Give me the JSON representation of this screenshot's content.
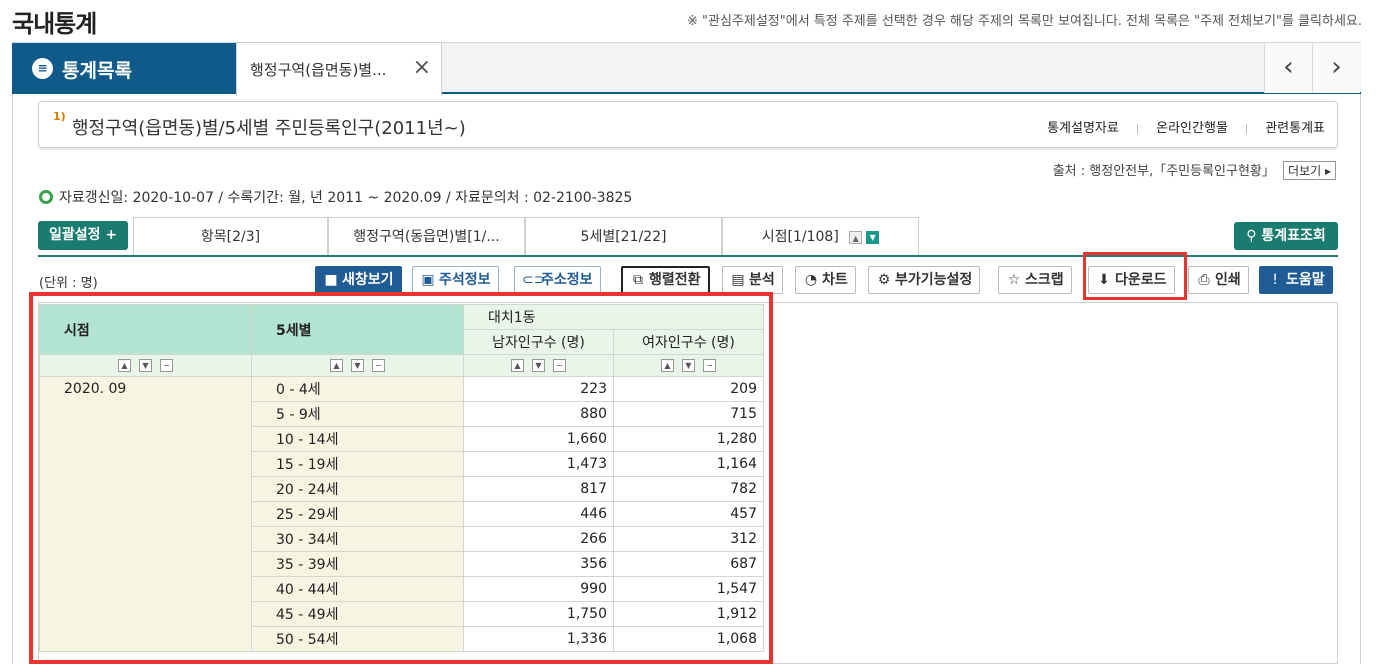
{
  "header": {
    "title": "국내통계",
    "notice": "※ \"관심주제설정\"에서 특정 주제를 선택한 경우 해당 주제의 목록만 보여집니다. 전체 목록은 \"주제 전체보기\"를 클릭하세요."
  },
  "tabs": {
    "list_icon": "list-icon",
    "list_label": "통계목록",
    "active_label": "행정구역(읍면동)별...",
    "close": "×",
    "prev": "‹",
    "next": "›"
  },
  "title_box": {
    "sup": "1)",
    "title": "행정구역(읍면동)별/5세별 주민등록인구(2011년~)",
    "links": [
      "통계설명자료",
      "온라인간행물",
      "관련통계표"
    ]
  },
  "source": {
    "text": "출처 : 행정안전부,「주민등록인구현황」",
    "more": "더보기 ▸"
  },
  "info": "자료갱신일: 2020-10-07 / 수록기간: 월, 년 2011 ~ 2020.09 / 자료문의처 : 02-2100-3825",
  "filters": {
    "bulk": "일괄설정 +",
    "tabs": [
      "항목[2/3]",
      "행정구역(동읍면)별[1/...",
      "5세별[21/22]",
      "시점[1/108]"
    ],
    "query": "통계표조회"
  },
  "unit": "(단위 : 명)",
  "toolbar": [
    {
      "icon": "■",
      "label": "새창보기"
    },
    {
      "icon": "▣",
      "label": "주석정보"
    },
    {
      "icon": "⊂⊃",
      "label": "주소정보"
    },
    {
      "icon": "⧉",
      "label": "행렬전환"
    },
    {
      "icon": "▤",
      "label": "분석"
    },
    {
      "icon": "◔",
      "label": "차트"
    },
    {
      "icon": "⚙",
      "label": "부가기능설정"
    },
    {
      "icon": "☆",
      "label": "스크랩"
    },
    {
      "icon": "⬇",
      "label": "다운로드"
    },
    {
      "icon": "⎙",
      "label": "인쇄"
    },
    {
      "icon": "!",
      "label": "도움말"
    }
  ],
  "table": {
    "col_time": "시점",
    "col_age": "5세별",
    "region": "대치1동",
    "col_male": "남자인구수 (명)",
    "col_female": "여자인구수 (명)",
    "period": "2020. 09",
    "rows": [
      {
        "age": "0 - 4세",
        "male": "223",
        "female": "209"
      },
      {
        "age": "5 - 9세",
        "male": "880",
        "female": "715"
      },
      {
        "age": "10 - 14세",
        "male": "1,660",
        "female": "1,280"
      },
      {
        "age": "15 - 19세",
        "male": "1,473",
        "female": "1,164"
      },
      {
        "age": "20 - 24세",
        "male": "817",
        "female": "782"
      },
      {
        "age": "25 - 29세",
        "male": "446",
        "female": "457"
      },
      {
        "age": "30 - 34세",
        "male": "266",
        "female": "312"
      },
      {
        "age": "35 - 39세",
        "male": "356",
        "female": "687"
      },
      {
        "age": "40 - 44세",
        "male": "990",
        "female": "1,547"
      },
      {
        "age": "45 - 49세",
        "male": "1,750",
        "female": "1,912"
      },
      {
        "age": "50 - 54세",
        "male": "1,336",
        "female": "1,068"
      }
    ]
  },
  "colors": {
    "tab_blue": "#105a8a",
    "teal_button": "#1a7b6f",
    "highlight_red": "#e8342f",
    "header_green": "#b3e3d1"
  }
}
